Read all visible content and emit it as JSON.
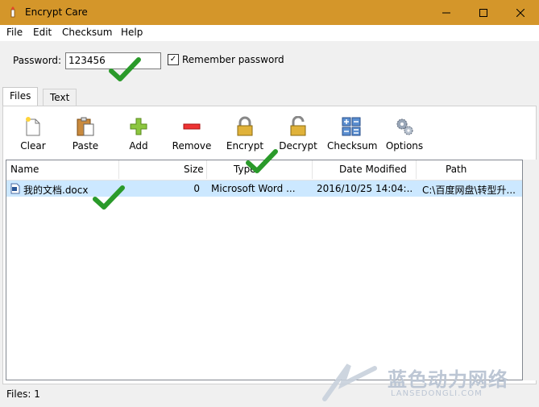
{
  "window": {
    "title": "Encrypt Care"
  },
  "menu": [
    "File",
    "Edit",
    "Checksum",
    "Help"
  ],
  "password": {
    "label": "Password:",
    "value": "123456"
  },
  "remember": {
    "label": "Remember password",
    "checked": true
  },
  "tabs": [
    {
      "label": "Files",
      "active": true
    },
    {
      "label": "Text",
      "active": false
    }
  ],
  "toolbar": [
    {
      "label": "Clear",
      "icon": "clear-icon"
    },
    {
      "label": "Paste",
      "icon": "paste-icon"
    },
    {
      "label": "Add",
      "icon": "add-icon"
    },
    {
      "label": "Remove",
      "icon": "remove-icon"
    },
    {
      "label": "Encrypt",
      "icon": "lock-icon"
    },
    {
      "label": "Decrypt",
      "icon": "unlock-icon"
    },
    {
      "label": "Checksum",
      "icon": "calculator-icon"
    },
    {
      "label": "Options",
      "icon": "gears-icon"
    }
  ],
  "table": {
    "columns": [
      "Name",
      "Size",
      "Type",
      "Date Modified",
      "Path"
    ],
    "rows": [
      {
        "name": "我的文档.docx",
        "size": "0",
        "type": "Microsoft Word ...",
        "date": "2016/10/25 14:04:...",
        "path": "C:\\百度网盘\\转型升..."
      }
    ]
  },
  "status": {
    "text": "Files: 1"
  },
  "watermark": {
    "text": "蓝色动力网络",
    "subtext": "LANSEDONGLI.COM"
  },
  "colors": {
    "titlebar": "#d4962a",
    "selection": "#cce8ff",
    "check": "#2a9a2a"
  }
}
